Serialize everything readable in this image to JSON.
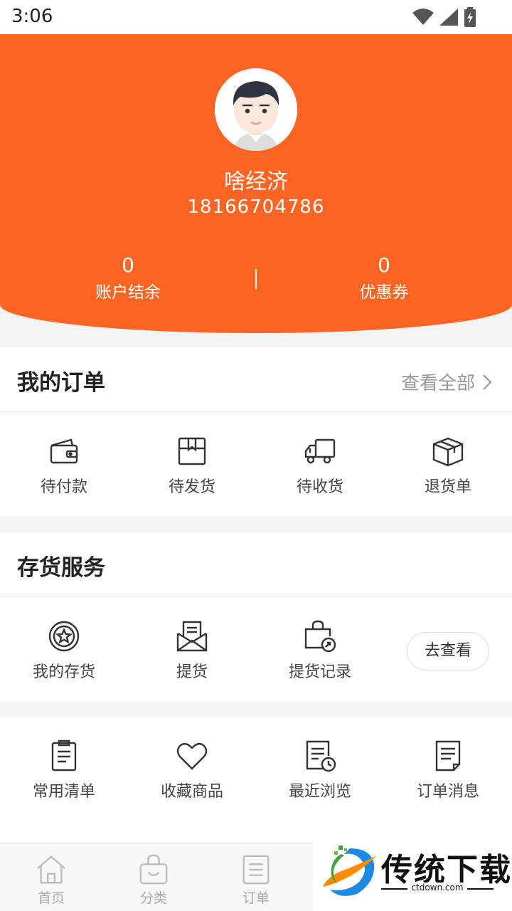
{
  "status": {
    "time": "3:06"
  },
  "profile": {
    "name": "啥经济",
    "phone": "18166704786"
  },
  "stats": [
    {
      "value": "0",
      "label": "账户结余"
    },
    {
      "value": "0",
      "label": "优惠券"
    }
  ],
  "orders": {
    "title": "我的订单",
    "view_all": "查看全部",
    "items": [
      {
        "label": "待付款",
        "icon": "wallet-icon"
      },
      {
        "label": "待发货",
        "icon": "package-icon"
      },
      {
        "label": "待收货",
        "icon": "truck-icon"
      },
      {
        "label": "退货单",
        "icon": "box-icon"
      }
    ]
  },
  "inventory": {
    "title": "存货服务",
    "items": [
      {
        "label": "我的存货",
        "icon": "star-badge-icon"
      },
      {
        "label": "提货",
        "icon": "envelope-icon"
      },
      {
        "label": "提货记录",
        "icon": "bag-record-icon"
      }
    ],
    "button": "去查看"
  },
  "tools": {
    "items": [
      {
        "label": "常用清单",
        "icon": "clipboard-icon"
      },
      {
        "label": "收藏商品",
        "icon": "heart-icon"
      },
      {
        "label": "最近浏览",
        "icon": "history-icon"
      },
      {
        "label": "订单消息",
        "icon": "document-icon"
      }
    ]
  },
  "tabbar": {
    "items": [
      {
        "label": "首页",
        "icon": "home-icon"
      },
      {
        "label": "分类",
        "icon": "shopping-bag-icon"
      },
      {
        "label": "订单",
        "icon": "list-icon"
      }
    ]
  },
  "watermark": {
    "text": "传统下载",
    "url": "ctdown.com"
  },
  "colors": {
    "accent": "#fb6422",
    "background": "#f4f4f4"
  }
}
